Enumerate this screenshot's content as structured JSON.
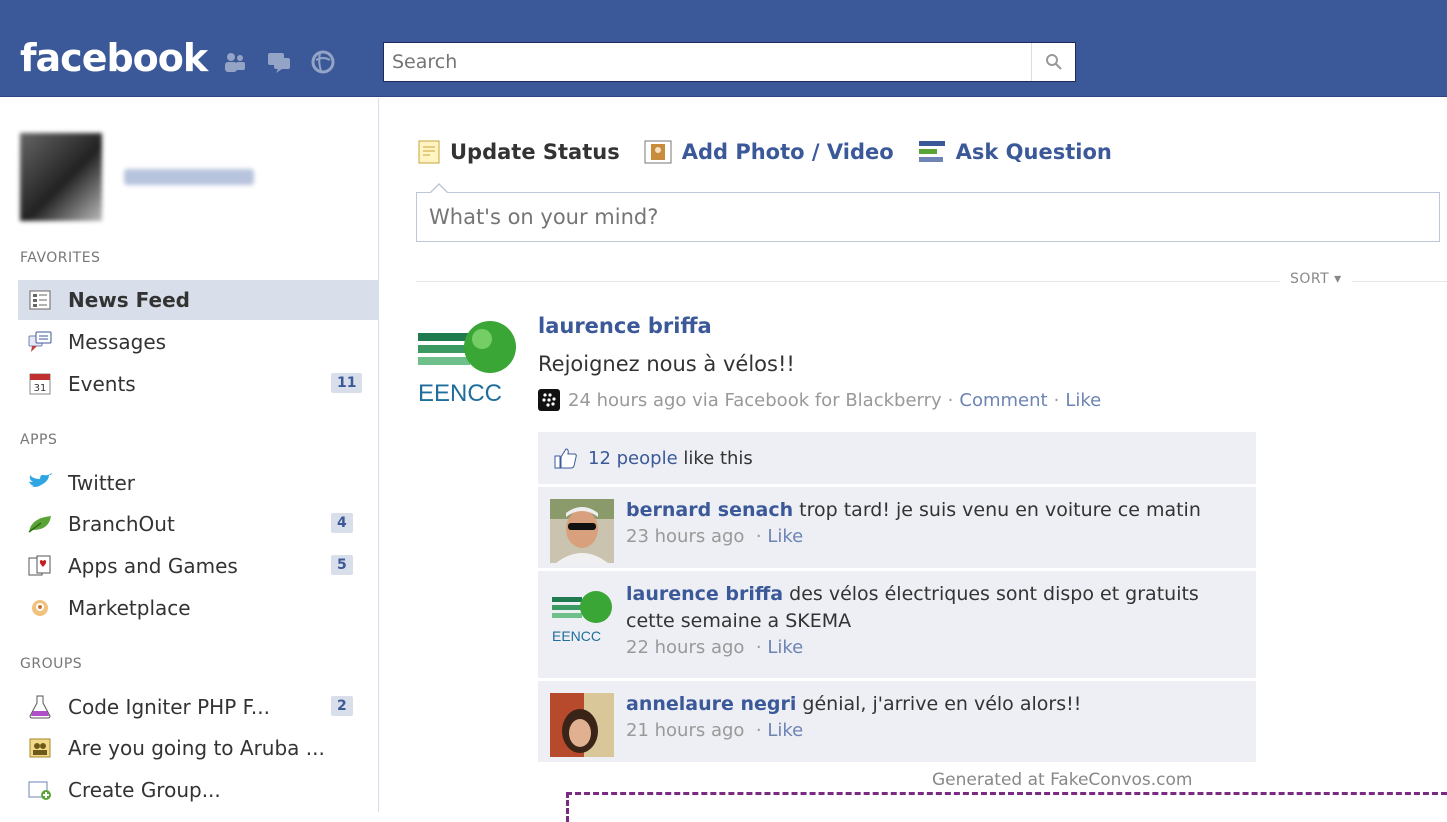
{
  "header": {
    "logo": "facebook",
    "search": {
      "placeholder": "Search",
      "value": ""
    },
    "brand_color": "#3b5998",
    "jewel_icons": [
      "friend-requests-icon",
      "messages-icon",
      "notifications-icon"
    ]
  },
  "sidebar": {
    "sections": {
      "favorites": "FAVORITES",
      "apps": "APPS",
      "groups": "GROUPS"
    },
    "favorites": [
      {
        "label": "News Feed",
        "icon": "news-feed-icon",
        "active": true
      },
      {
        "label": "Messages",
        "icon": "messages-icon"
      },
      {
        "label": "Events",
        "icon": "calendar-icon",
        "icon_text": "31",
        "count": "11"
      }
    ],
    "apps": [
      {
        "label": "Twitter",
        "icon": "twitter-bird-icon"
      },
      {
        "label": "BranchOut",
        "icon": "leaf-icon",
        "count": "4"
      },
      {
        "label": "Apps and Games",
        "icon": "apps-games-icon",
        "count": "5"
      },
      {
        "label": "Marketplace",
        "icon": "marketplace-icon"
      }
    ],
    "groups": [
      {
        "label": "Code Igniter PHP F...",
        "icon": "flask-icon",
        "count": "2"
      },
      {
        "label": "Are you going to Aruba ...",
        "icon": "group-icon"
      },
      {
        "label": "Create Group...",
        "icon": "create-group-icon"
      }
    ]
  },
  "composer": {
    "tabs": [
      "Update Status",
      "Add Photo / Video",
      "Ask Question"
    ],
    "placeholder": "What's on your mind?"
  },
  "feed": {
    "sort_label": "SORT",
    "story": {
      "author": "laurence briffa",
      "logo_text": "EENCC",
      "message": "Rejoignez nous à vélos!!",
      "time": "24 hours ago via Facebook for Blackberry",
      "sep": "·",
      "comment_label": "Comment",
      "like_label": "Like",
      "likes": {
        "link": "12 people",
        "suffix": " like this"
      },
      "comments": [
        {
          "author": "bernard senach",
          "text": " trop tard! je suis venu en voiture ce matin",
          "time": "23 hours ago",
          "like": "Like"
        },
        {
          "author": "laurence briffa",
          "text": " des vélos électriques sont dispo et gratuits cette semaine a SKEMA",
          "time": "22 hours ago",
          "like": "Like"
        },
        {
          "author": "annelaure negri",
          "text": " génial, j'arrive en vélo alors!!",
          "time": "21 hours ago",
          "like": "Like"
        }
      ]
    }
  },
  "watermark": "Generated at FakeConvos.com"
}
